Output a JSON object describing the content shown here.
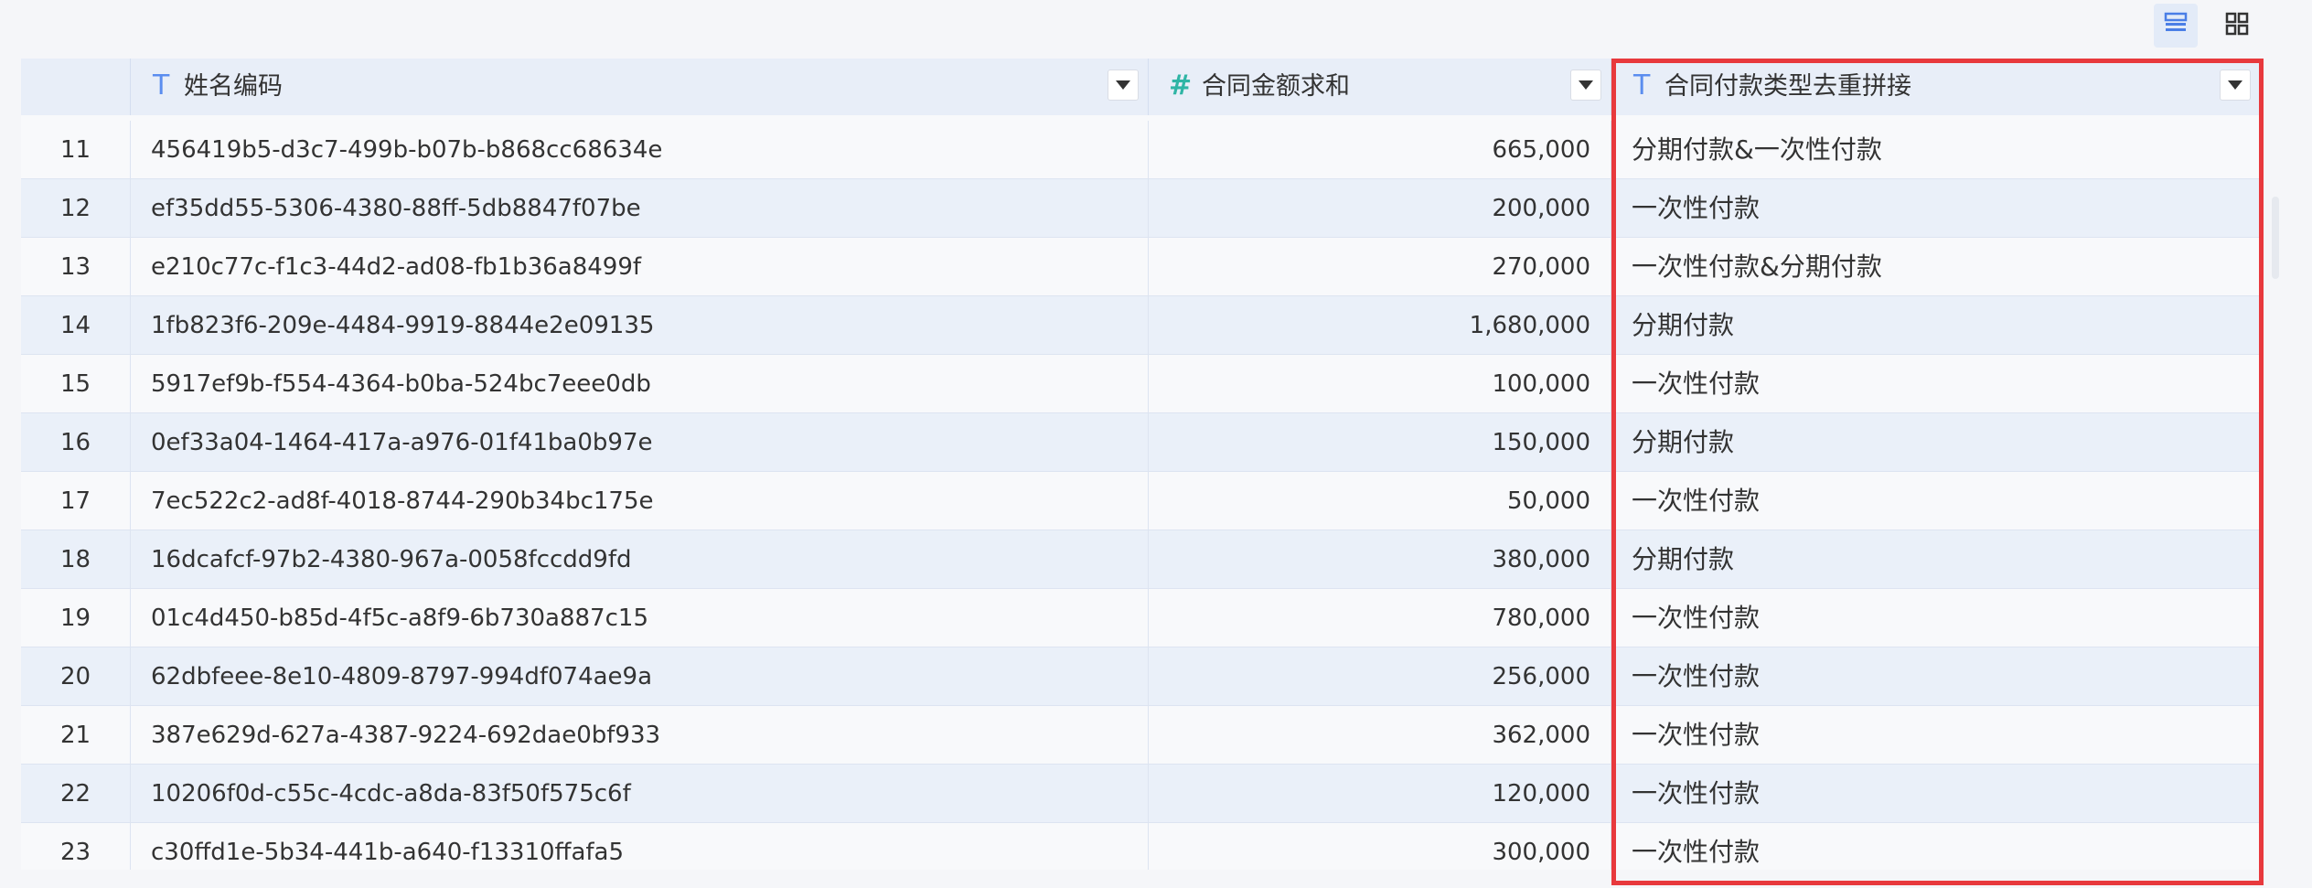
{
  "toolbar": {
    "list_view_icon": "table-view-icon",
    "grid_view_icon": "grid-view-icon"
  },
  "columns": [
    {
      "type_icon": "T",
      "title": "姓名编码"
    },
    {
      "type_icon": "#",
      "title": "合同金额求和"
    },
    {
      "type_icon": "T",
      "title": "合同付款类型去重拼接"
    }
  ],
  "rows": [
    {
      "idx": "11",
      "code": "456419b5-d3c7-499b-b07b-b868cc68634e",
      "amount": "665,000",
      "type": "分期付款&一次性付款"
    },
    {
      "idx": "12",
      "code": "ef35dd55-5306-4380-88ff-5db8847f07be",
      "amount": "200,000",
      "type": "一次性付款"
    },
    {
      "idx": "13",
      "code": "e210c77c-f1c3-44d2-ad08-fb1b36a8499f",
      "amount": "270,000",
      "type": "一次性付款&分期付款"
    },
    {
      "idx": "14",
      "code": "1fb823f6-209e-4484-9919-8844e2e09135",
      "amount": "1,680,000",
      "type": "分期付款"
    },
    {
      "idx": "15",
      "code": "5917ef9b-f554-4364-b0ba-524bc7eee0db",
      "amount": "100,000",
      "type": "一次性付款"
    },
    {
      "idx": "16",
      "code": "0ef33a04-1464-417a-a976-01f41ba0b97e",
      "amount": "150,000",
      "type": "分期付款"
    },
    {
      "idx": "17",
      "code": "7ec522c2-ad8f-4018-8744-290b34bc175e",
      "amount": "50,000",
      "type": "一次性付款"
    },
    {
      "idx": "18",
      "code": "16dcafcf-97b2-4380-967a-0058fccdd9fd",
      "amount": "380,000",
      "type": "分期付款"
    },
    {
      "idx": "19",
      "code": "01c4d450-b85d-4f5c-a8f9-6b730a887c15",
      "amount": "780,000",
      "type": "一次性付款"
    },
    {
      "idx": "20",
      "code": "62dbfeee-8e10-4809-8797-994df074ae9a",
      "amount": "256,000",
      "type": "一次性付款"
    },
    {
      "idx": "21",
      "code": "387e629d-627a-4387-9224-692dae0bf933",
      "amount": "362,000",
      "type": "一次性付款"
    },
    {
      "idx": "22",
      "code": "10206f0d-c55c-4cdc-a8da-83f50f575c6f",
      "amount": "120,000",
      "type": "一次性付款"
    },
    {
      "idx": "23",
      "code": "c30ffd1e-5b34-441b-a640-f13310ffafa5",
      "amount": "300,000",
      "type": "一次性付款"
    }
  ],
  "colors": {
    "highlight_border": "#e8393d",
    "header_bg": "#e8eef8",
    "row_alt_bg": "#eaf0f9"
  }
}
